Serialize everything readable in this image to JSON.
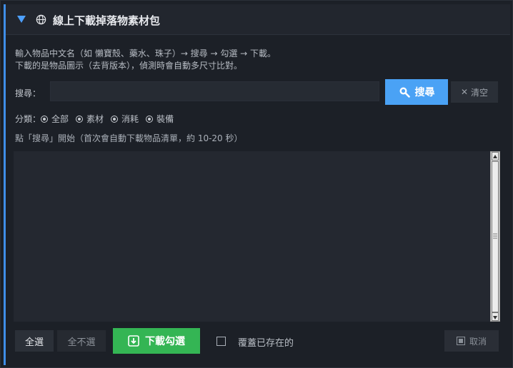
{
  "header": {
    "title": "線上下載掉落物素材包",
    "collapse_icon": "triangle-down-icon",
    "globe_icon": "globe-icon"
  },
  "description": {
    "line1": "輸入物品中文名（如 懶寶殼、藥水、珠子）→ 搜尋 → 勾選 → 下載。",
    "line2": "下載的是物品圖示（去背版本），偵測時會自動多尺寸比對。"
  },
  "search": {
    "label": "搜尋：",
    "value": "",
    "placeholder": "",
    "button_label": "搜尋",
    "clear_label": "清空"
  },
  "categories": {
    "label": "分類：",
    "options": [
      "全部",
      "素材",
      "消耗",
      "裝備"
    ]
  },
  "hint": "點「搜尋」開始（首次會自動下載物品清單，約 10-20 秒）",
  "footer": {
    "select_all": "全選",
    "select_none": "全不選",
    "download_label": "下載勾選",
    "overwrite_label": "覆蓋已存在的",
    "cancel_label": "取消"
  },
  "colors": {
    "accent": "#3f8ee8",
    "search_button": "#4aa2f5",
    "download_button": "#34b554"
  }
}
